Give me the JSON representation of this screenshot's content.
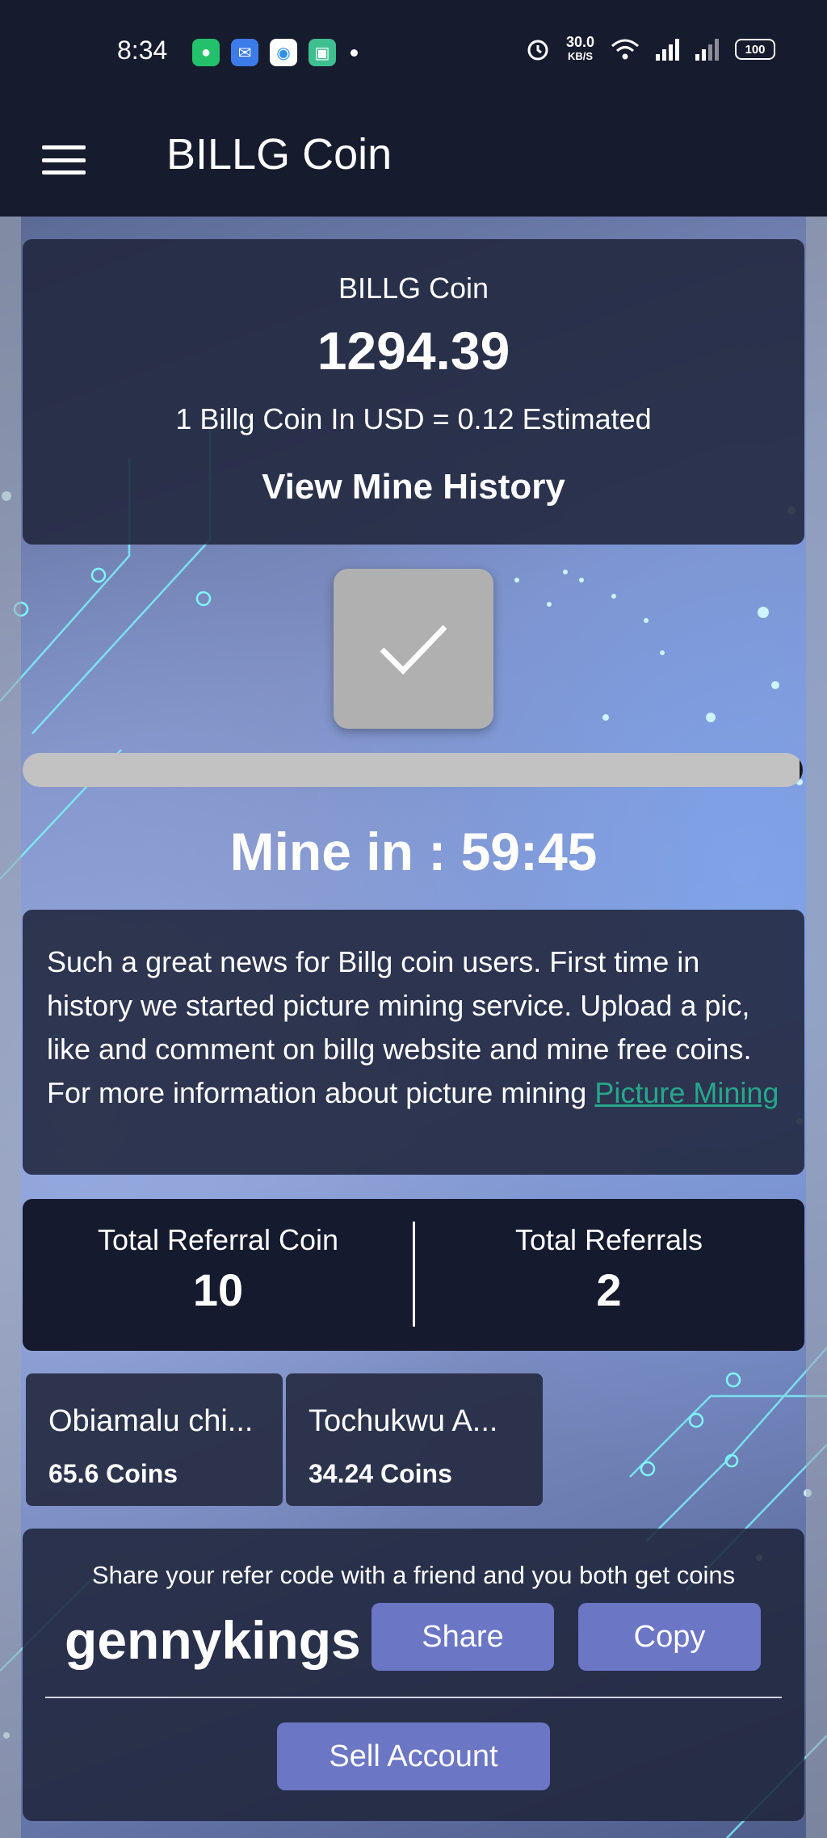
{
  "status_bar": {
    "time": "8:34",
    "net_speed": "30.0",
    "net_unit": "KB/S",
    "battery": "100",
    "app_icons": [
      "shield-icon",
      "mail-icon",
      "browser-icon",
      "gift-icon"
    ],
    "indicators": [
      "alarm-icon",
      "wifi-icon",
      "signal-h-icon",
      "signal-4g-icon"
    ]
  },
  "app_bar": {
    "title": "BILLG Coin"
  },
  "balance": {
    "label": "BILLG Coin",
    "value": "1294.39",
    "usd_rate": "1 Billg Coin In USD = 0.12 Estimated",
    "history_link": "View Mine History"
  },
  "mining": {
    "button_icon": "checkmark-icon",
    "progress_fraction": 0.004,
    "timer": "Mine in : 59:45"
  },
  "news": {
    "text": "Such a great news for Billg coin users. First time in history we started picture mining service. Upload a pic, like and comment on billg website and mine free coins. For more information about picture mining ",
    "link": "Picture Mining"
  },
  "referral_stats": {
    "total_coin_label": "Total Referral Coin",
    "total_coin_value": "10",
    "total_referrals_label": "Total Referrals",
    "total_referrals_value": "2"
  },
  "referrals": [
    {
      "name": "Obiamalu chi...",
      "coins": "65.6 Coins"
    },
    {
      "name": "Tochukwu A...",
      "coins": "34.24 Coins"
    }
  ],
  "share": {
    "text": "Share your refer code with a friend and you both get coins",
    "code": "gennykings",
    "share_label": "Share",
    "copy_label": "Copy",
    "sell_label": "Sell Account"
  },
  "colors": {
    "bar": "#171b2e",
    "card": "#20253c",
    "button": "#6b76c5",
    "link": "#26a78a"
  }
}
